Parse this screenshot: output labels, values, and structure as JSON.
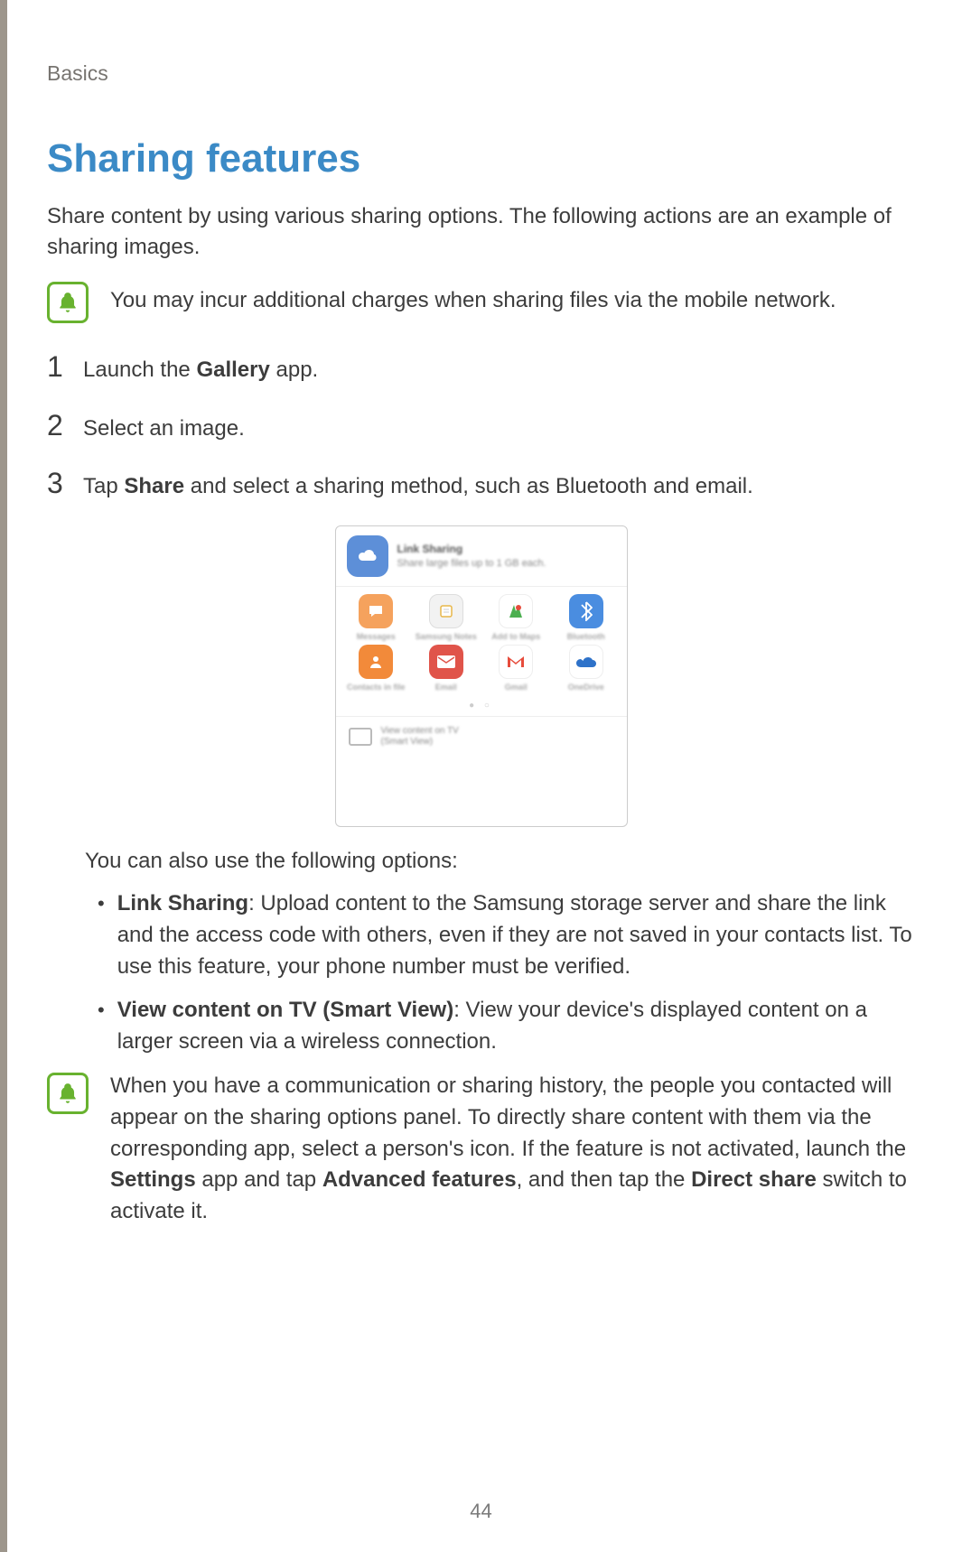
{
  "header": {
    "section": "Basics"
  },
  "title": "Sharing features",
  "intro": "Share content by using various sharing options. The following actions are an example of sharing images.",
  "note1": "You may incur additional charges when sharing files via the mobile network.",
  "steps": [
    {
      "num": "1",
      "pre": "Launch the ",
      "bold": "Gallery",
      "post": " app."
    },
    {
      "num": "2",
      "pre": "Select an image.",
      "bold": "",
      "post": ""
    },
    {
      "num": "3",
      "pre": "Tap ",
      "bold": "Share",
      "post": " and select a sharing method, such as Bluetooth and email."
    }
  ],
  "screenshot": {
    "top_title": "Link Sharing",
    "top_sub": "Share large files up to 1 GB each.",
    "apps": [
      "Messages",
      "Samsung Notes",
      "Add to Maps",
      "Bluetooth",
      "Contacts in file",
      "Email",
      "Gmail",
      "OneDrive"
    ],
    "bottom_title": "View content on TV",
    "bottom_sub": "(Smart View)"
  },
  "follow": "You can also use the following options:",
  "bullets": [
    {
      "bold": "Link Sharing",
      "text": ": Upload content to the Samsung storage server and share the link and the access code with others, even if they are not saved in your contacts list. To use this feature, your phone number must be verified."
    },
    {
      "bold": "View content on TV (Smart View)",
      "text": ": View your device's displayed content on a larger screen via a wireless connection."
    }
  ],
  "note2": {
    "p1": "When you have a communication or sharing history, the people you contacted will appear on the sharing options panel. To directly share content with them via the corresponding app, select a person's icon. If the feature is not activated, launch the ",
    "b1": "Settings",
    "p2": " app and tap ",
    "b2": "Advanced features",
    "p3": ", and then tap the ",
    "b3": "Direct share",
    "p4": " switch to activate it."
  },
  "page_number": "44"
}
